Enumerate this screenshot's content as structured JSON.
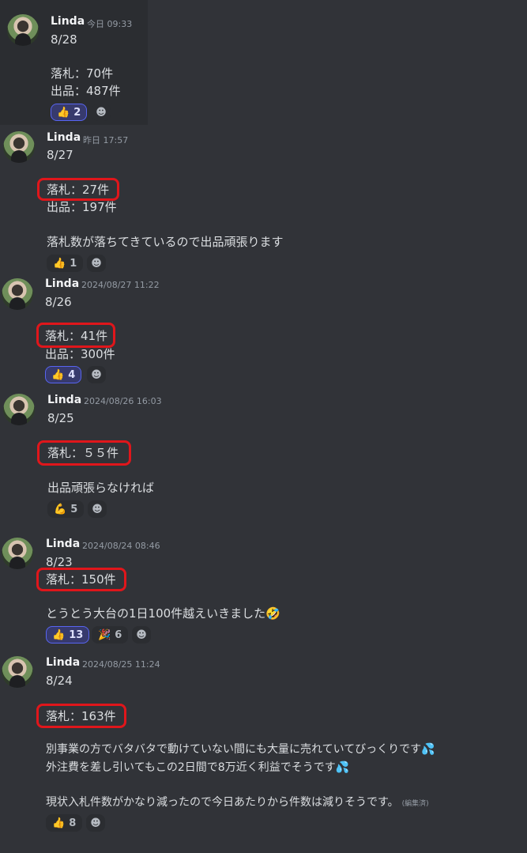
{
  "messages": [
    {
      "author": "Linda",
      "time": "今日 09:33",
      "lines": [
        "8/28",
        "",
        "落札：70件",
        "出品：487件"
      ],
      "reactions": [
        {
          "emoji": "👍",
          "count": "2",
          "me": true
        }
      ]
    },
    {
      "author": "Linda",
      "time": "昨日 17:57",
      "lines": [
        "8/27",
        "",
        "落札：27件",
        "出品：197件",
        "",
        "落札数が落ちてきているので出品頑張ります"
      ],
      "reactions": [
        {
          "emoji": "👍",
          "count": "1",
          "me": false
        }
      ]
    },
    {
      "author": "Linda",
      "time": "2024/08/27 11:22",
      "lines": [
        "8/26",
        "",
        "落札：41件",
        "出品：300件"
      ],
      "reactions": [
        {
          "emoji": "👍",
          "count": "4",
          "me": true
        }
      ]
    },
    {
      "author": "Linda",
      "time": "2024/08/26 16:03",
      "lines": [
        "8/25",
        "",
        "落札：５５件",
        "",
        "出品頑張らなければ"
      ],
      "reactions": [
        {
          "emoji": "💪",
          "count": "5",
          "me": false
        }
      ]
    },
    {
      "author": "Linda",
      "time": "2024/08/24 08:46",
      "lines": [
        "8/23",
        "落札：150件",
        "",
        "とうとう大台の1日100件越えいきました🤣"
      ],
      "reactions": [
        {
          "emoji": "👍",
          "count": "13",
          "me": true
        },
        {
          "emoji": "🎉",
          "count": "6",
          "me": false
        }
      ]
    },
    {
      "author": "Linda",
      "time": "2024/08/25 11:24",
      "lines": [
        "8/24",
        "",
        "落札：163件",
        "",
        "別事業の方でバタバタで動けていない間にも大量に売れていてびっくりです💦",
        "外注費を差し引いてもこの2日間で8万近く利益でそうです💦",
        "",
        "現状入札件数がかなり減ったので今日あたりから件数は減りそうです。"
      ],
      "edited": "(編集済)",
      "reactions": [
        {
          "emoji": "👍",
          "count": "8",
          "me": false
        }
      ]
    }
  ],
  "icons": {
    "add_reaction": "smile-plus-icon"
  },
  "colors": {
    "highlight_box": "#e0161b",
    "background": "#313338"
  }
}
